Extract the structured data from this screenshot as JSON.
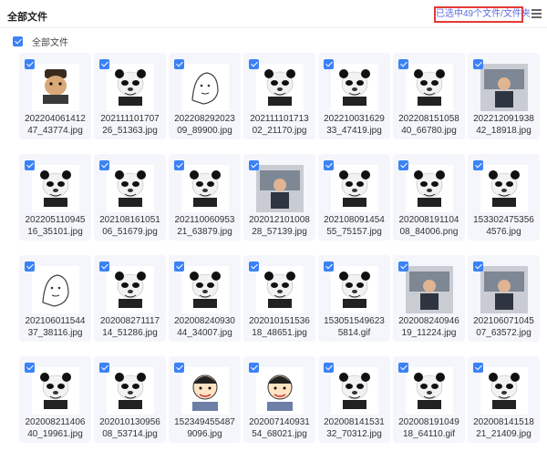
{
  "header": {
    "title": "全部文件",
    "status": "已选中49个文件/文件夹",
    "menu_icon": "hamburger-menu-icon"
  },
  "toolbar": {
    "select_all_label": "全部文件"
  },
  "colors": {
    "accent": "#3b82f6",
    "status_border": "#e53935",
    "status_text": "#5b6cdb"
  },
  "files": [
    {
      "line1": "202204061412",
      "line2": "47_43774.jpg",
      "caption": "专属  卑微  又穷",
      "variant": "dog"
    },
    {
      "line1": "202111101707",
      "line2": "26_51363.jpg",
      "caption": "不打游戏了,工作",
      "variant": "panda"
    },
    {
      "line1": "202208292023",
      "line2": "09_89900.jpg",
      "caption": "",
      "variant": "sketch"
    },
    {
      "line1": "202111101713",
      "line2": "02_21170.jpg",
      "caption": "新卡都来注意了",
      "variant": "panda"
    },
    {
      "line1": "202210031629",
      "line2": "33_47419.jpg",
      "caption": "打都打翻肚肚蛋了",
      "variant": "panda"
    },
    {
      "line1": "202208151058",
      "line2": "40_66780.jpg",
      "caption": "噢！打游戏被抓",
      "variant": "panda"
    },
    {
      "line1": "202212091938",
      "line2": "42_18918.jpg",
      "caption": "",
      "variant": "photo"
    },
    {
      "line1": "202205110945",
      "line2": "16_35101.jpg",
      "caption": "气我要哭   哈哈",
      "variant": "panda"
    },
    {
      "line1": "202108161051",
      "line2": "06_51679.jpg",
      "caption": "是不是",
      "variant": "panda"
    },
    {
      "line1": "202110060953",
      "line2": "21_63879.jpg",
      "caption": "",
      "variant": "panda"
    },
    {
      "line1": "202012101008",
      "line2": "28_57139.jpg",
      "caption": "",
      "variant": "photo"
    },
    {
      "line1": "202108091454",
      "line2": "55_75157.jpg",
      "caption": "",
      "variant": "panda"
    },
    {
      "line1": "202008191104",
      "line2": "08_84006.png",
      "caption": "重要的事情说三遍",
      "variant": "panda"
    },
    {
      "line1": "153302475356",
      "line2": "4576.jpg",
      "caption": "你是不是",
      "variant": "panda"
    },
    {
      "line1": "202106011544",
      "line2": "37_38116.jpg",
      "caption": "拜托！",
      "variant": "sketch"
    },
    {
      "line1": "202008271117",
      "line2": "14_51286.jpg",
      "caption": "最后了啊啊",
      "variant": "panda"
    },
    {
      "line1": "202008240930",
      "line2": "44_34007.jpg",
      "caption": "一脸懵逼",
      "variant": "panda"
    },
    {
      "line1": "202010151536",
      "line2": "18_48651.jpg",
      "caption": "不玩了  我累了",
      "variant": "panda"
    },
    {
      "line1": "153051549623",
      "line2": "5814.gif",
      "caption": "",
      "variant": "panda"
    },
    {
      "line1": "202008240946",
      "line2": "19_11224.jpg",
      "caption": "",
      "variant": "photo"
    },
    {
      "line1": "202106071045",
      "line2": "07_63572.jpg",
      "caption": "",
      "variant": "photo"
    },
    {
      "line1": "202008211406",
      "line2": "40_19961.jpg",
      "caption": "你是傻逼一样",
      "variant": "panda"
    },
    {
      "line1": "202010130956",
      "line2": "08_53714.jpg",
      "caption": "",
      "variant": "panda"
    },
    {
      "line1": "152349455487",
      "line2": "9096.jpg",
      "caption": "别玩游戏来玩手",
      "variant": "cartoon"
    },
    {
      "line1": "202007140931",
      "line2": "54_68021.jpg",
      "caption": "",
      "variant": "cartoon"
    },
    {
      "line1": "202008141531",
      "line2": "32_70312.jpg",
      "caption": "",
      "variant": "panda"
    },
    {
      "line1": "202008191049",
      "line2": "18_64110.gif",
      "caption": "来一把？",
      "variant": "panda"
    },
    {
      "line1": "202008141518",
      "line2": "21_21409.jpg",
      "caption": "发出萝卜吧",
      "variant": "panda"
    }
  ]
}
